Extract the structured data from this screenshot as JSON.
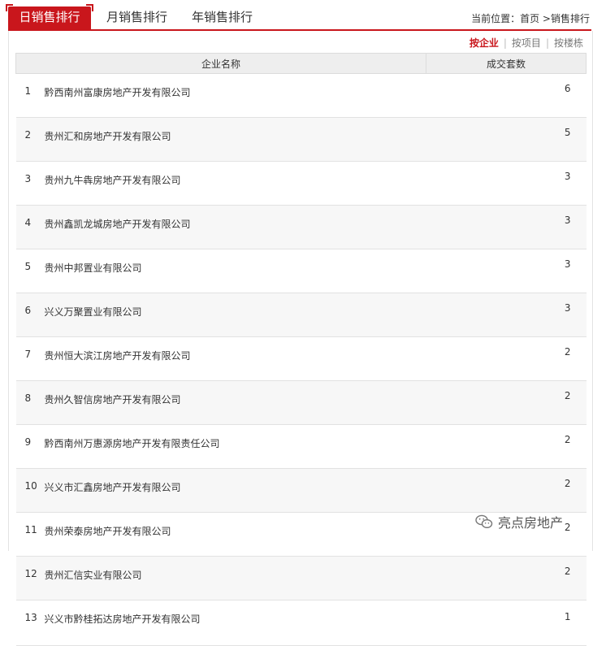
{
  "tabs": [
    {
      "label": "日销售排行",
      "active": true
    },
    {
      "label": "月销售排行",
      "active": false
    },
    {
      "label": "年销售排行",
      "active": false
    }
  ],
  "location": {
    "prefix": "当前位置：",
    "home": "首页",
    "sep": " >",
    "current": "销售排行"
  },
  "sort": {
    "by_company": "按企业",
    "by_project": "按项目",
    "by_building": "按楼栋",
    "sep": "|"
  },
  "table": {
    "headers": [
      "企业名称",
      "成交套数"
    ],
    "rows": [
      {
        "rank": "1",
        "name": "黔西南州富康房地产开发有限公司",
        "count": "6"
      },
      {
        "rank": "2",
        "name": "贵州汇和房地产开发有限公司",
        "count": "5"
      },
      {
        "rank": "3",
        "name": "贵州九牛犇房地产开发有限公司",
        "count": "3"
      },
      {
        "rank": "4",
        "name": "贵州鑫凯龙城房地产开发有限公司",
        "count": "3"
      },
      {
        "rank": "5",
        "name": "贵州中邦置业有限公司",
        "count": "3"
      },
      {
        "rank": "6",
        "name": "兴义万聚置业有限公司",
        "count": "3"
      },
      {
        "rank": "7",
        "name": "贵州恒大滨江房地产开发有限公司",
        "count": "2"
      },
      {
        "rank": "8",
        "name": "贵州久智信房地产开发有限公司",
        "count": "2"
      },
      {
        "rank": "9",
        "name": "黔西南州万惠源房地产开发有限责任公司",
        "count": "2"
      },
      {
        "rank": "10",
        "name": "兴义市汇鑫房地产开发有限公司",
        "count": "2"
      },
      {
        "rank": "11",
        "name": "贵州荣泰房地产开发有限公司",
        "count": "2"
      },
      {
        "rank": "12",
        "name": "贵州汇信实业有限公司",
        "count": "2"
      },
      {
        "rank": "13",
        "name": "兴义市黔桂拓达房地产开发有限公司",
        "count": "1"
      }
    ]
  },
  "watermark": {
    "text": "亮点房地产",
    "icon": "wechat-icon"
  },
  "colors": {
    "accent": "#c9161c",
    "header_bg": "#eeeeee",
    "stripe": "#f7f7f7"
  }
}
